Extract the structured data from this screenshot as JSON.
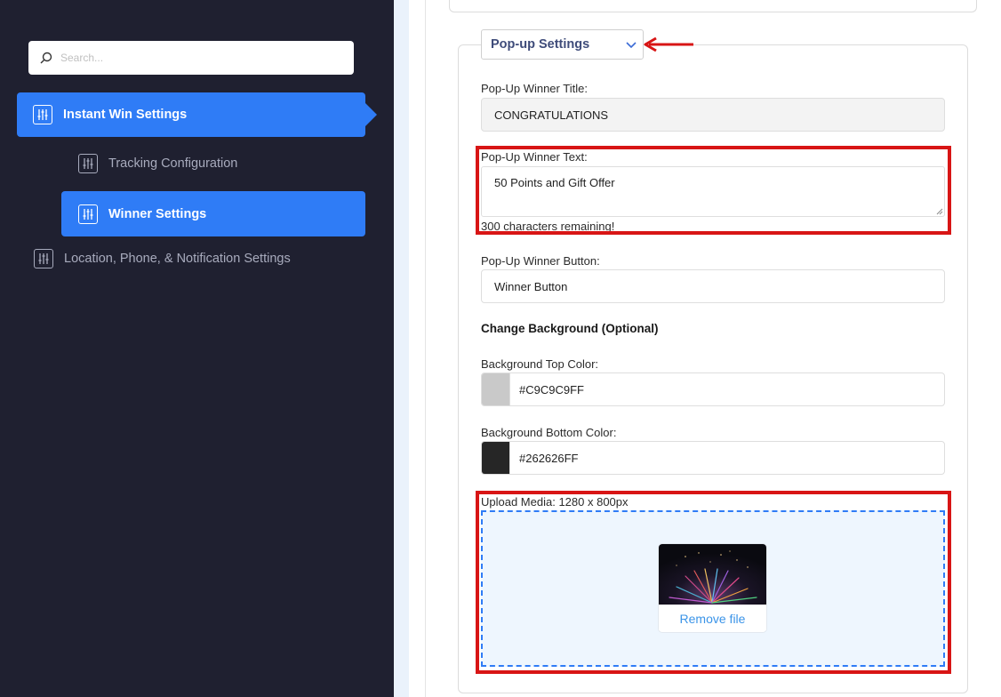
{
  "sidebar": {
    "search_placeholder": "Search...",
    "items": [
      {
        "label": "Instant Win Settings",
        "active": true
      },
      {
        "label": "Tracking Configuration",
        "active": false
      },
      {
        "label": "Winner Settings",
        "active": true
      },
      {
        "label": "Location, Phone, & Notification Settings",
        "active": false
      }
    ]
  },
  "popup_settings": {
    "section_title": "Pop-up Settings",
    "winner_title_label": "Pop-Up Winner Title:",
    "winner_title_value": "CONGRATULATIONS",
    "winner_text_label": "Pop-Up Winner Text:",
    "winner_text_value": "50 Points and Gift Offer",
    "chars_remaining": "300 characters remaining!",
    "winner_button_label": "Pop-Up Winner Button:",
    "winner_button_value": "Winner Button",
    "change_background_heading": "Change Background (Optional)",
    "bg_top_label": "Background Top Color:",
    "bg_top_value": "#C9C9C9FF",
    "bg_bottom_label": "Background Bottom Color:",
    "bg_bottom_value": "#262626FF",
    "upload_label": "Upload Media: 1280 x 800px",
    "remove_file": "Remove file"
  },
  "colors": {
    "sidebar_bg": "#1f2030",
    "accent": "#2f7cf6",
    "highlight": "#d81515",
    "swatch_top": "#c9c9c9",
    "swatch_bottom": "#262626"
  }
}
